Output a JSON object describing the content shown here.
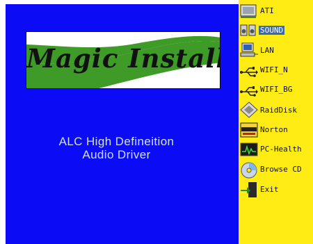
{
  "logo": {
    "text": "Magic Install"
  },
  "driver": {
    "line1": "ALC High Defineition",
    "line2": "Audio Driver"
  },
  "colors": {
    "left_bg": "#0b0bf5",
    "right_bg": "#ffec14",
    "selected_bg": "#3a69a8",
    "logo_green": "#3e9b27"
  },
  "menu": {
    "items": [
      {
        "label": "ATI",
        "icon": "monitor-card-icon",
        "selected": false
      },
      {
        "label": "SOUND",
        "icon": "speaker-icon",
        "selected": true
      },
      {
        "label": "LAN",
        "icon": "network-computer-icon",
        "selected": false
      },
      {
        "label": "WIFI_N",
        "icon": "usb-icon",
        "selected": false
      },
      {
        "label": "WIFI_BG",
        "icon": "usb-icon",
        "selected": false
      },
      {
        "label": "RaidDisk",
        "icon": "raid-disk-icon",
        "selected": false
      },
      {
        "label": "Norton",
        "icon": "norton-icon",
        "selected": false
      },
      {
        "label": "PC-Health",
        "icon": "pc-health-monitor-icon",
        "selected": false
      },
      {
        "label": "Browse CD",
        "icon": "cd-icon",
        "selected": false
      },
      {
        "label": "Exit",
        "icon": "exit-door-icon",
        "selected": false
      }
    ]
  }
}
